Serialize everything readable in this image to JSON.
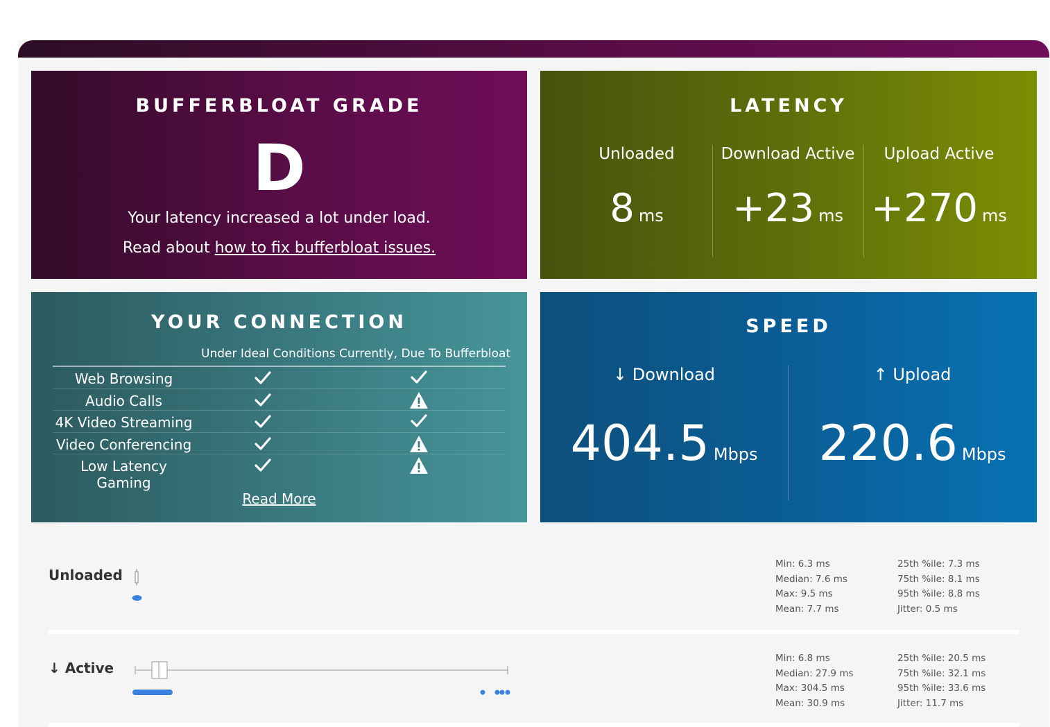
{
  "grade": {
    "title": "BUFFERBLOAT GRADE",
    "letter": "D",
    "description": "Your latency increased a lot under load.",
    "read_prefix": "Read about ",
    "read_link": "how to fix bufferbloat issues."
  },
  "latency": {
    "title": "LATENCY",
    "columns": [
      {
        "label": "Unloaded",
        "value": "8",
        "unit": "ms"
      },
      {
        "label": "Download Active",
        "value": "+23",
        "unit": "ms"
      },
      {
        "label": "Upload Active",
        "value": "+270",
        "unit": "ms"
      }
    ]
  },
  "connection": {
    "title": "YOUR CONNECTION",
    "col_ideal": "Under Ideal Conditions",
    "col_current": "Currently, Due To Bufferbloat",
    "rows": [
      {
        "name": "Web Browsing",
        "ideal": "check-icon",
        "current": "check-icon"
      },
      {
        "name": "Audio Calls",
        "ideal": "check-icon",
        "current": "warning-icon"
      },
      {
        "name": "4K Video Streaming",
        "ideal": "check-icon",
        "current": "check-icon"
      },
      {
        "name": "Video Conferencing",
        "ideal": "check-icon",
        "current": "warning-icon"
      },
      {
        "name": "Low Latency Gaming",
        "ideal": "check-icon",
        "current": "warning-icon"
      }
    ],
    "read_more": "Read More"
  },
  "speed": {
    "title": "SPEED",
    "download": {
      "label": "↓ Download",
      "value": "404.5",
      "unit": "Mbps"
    },
    "upload": {
      "label": "↑ Upload",
      "value": "220.6",
      "unit": "Mbps"
    }
  },
  "details": {
    "unloaded": {
      "label": "Unloaded",
      "left": [
        "Min: 6.3 ms",
        "Median: 7.6 ms",
        "Max: 9.5 ms",
        "Mean: 7.7 ms"
      ],
      "right": [
        "25th %ile: 7.3 ms",
        "75th %ile: 8.1 ms",
        "95th %ile: 8.8 ms",
        "Jitter: 0.5 ms"
      ]
    },
    "active": {
      "label": "↓ Active",
      "left": [
        "Min: 6.8 ms",
        "Median: 27.9 ms",
        "Max: 304.5 ms",
        "Mean: 30.9 ms"
      ],
      "right": [
        "25th %ile: 20.5 ms",
        "75th %ile: 32.1 ms",
        "95th %ile: 33.6 ms",
        "Jitter: 11.7 ms"
      ]
    }
  },
  "colors": {
    "grade": "#5a0d48",
    "latency": "#5f6e0a",
    "connection": "#3a7a80",
    "speed": "#0a5d95",
    "dots": "#3b82e0"
  }
}
